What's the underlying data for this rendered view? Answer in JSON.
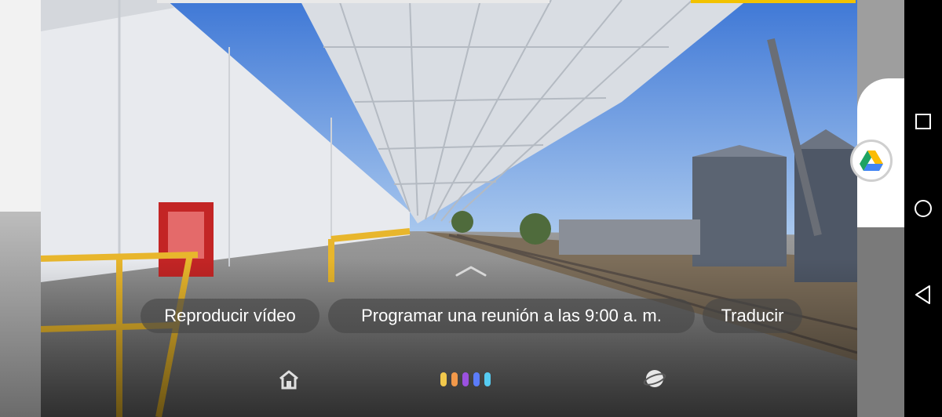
{
  "suggestions": {
    "play_video": "Reproducir vídeo",
    "schedule_meeting": "Programar una reunión a las 9:00 a. m.",
    "translate": "Traducir"
  },
  "bottom_bar": {
    "home_icon": "home-icon",
    "assistant_dots": [
      "#f2c94c",
      "#f2994a",
      "#9b51e0",
      "#5b7cfa",
      "#56ccf2"
    ],
    "lens_icon": "lens-planet-icon"
  },
  "side": {
    "drive_icon": "google-drive-icon"
  },
  "nav": {
    "recents": "square-recents-icon",
    "home": "circle-home-icon",
    "back": "triangle-back-icon"
  }
}
